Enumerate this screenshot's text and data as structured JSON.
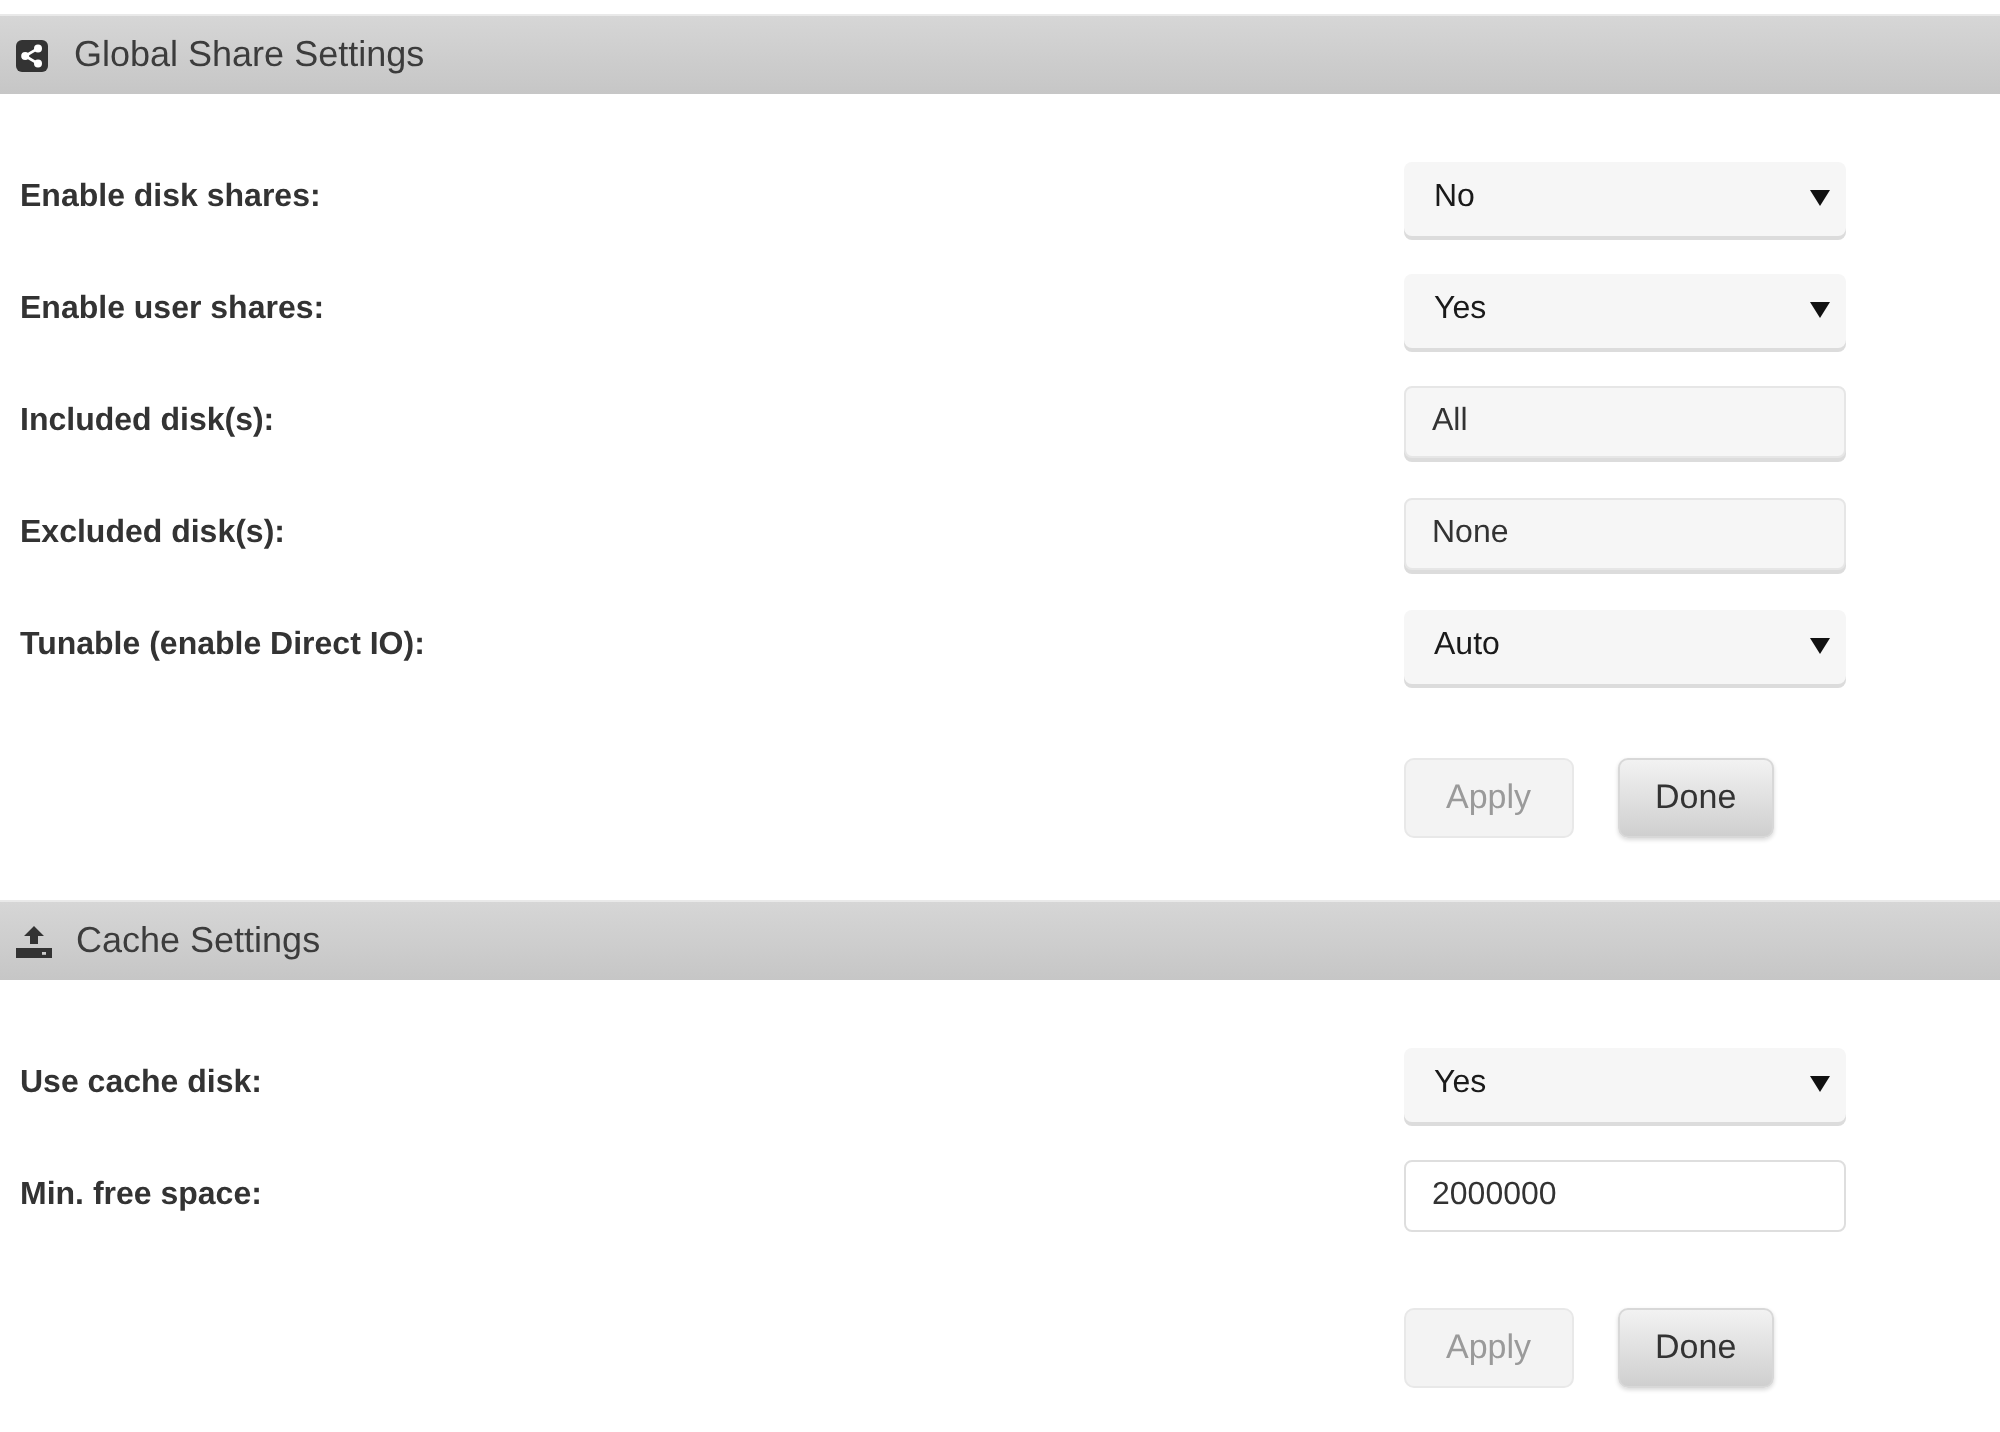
{
  "sections": [
    {
      "title": "Global Share Settings",
      "fields": [
        {
          "label": "Enable disk shares:",
          "kind": "select",
          "value": "No",
          "disabled": false
        },
        {
          "label": "Enable user shares:",
          "kind": "select",
          "value": "Yes",
          "disabled": false
        },
        {
          "label": "Included disk(s):",
          "kind": "text",
          "value": "All",
          "disabled": true
        },
        {
          "label": "Excluded disk(s):",
          "kind": "text",
          "value": "None",
          "disabled": true
        },
        {
          "label": "Tunable (enable Direct IO):",
          "kind": "select",
          "value": "Auto",
          "disabled": false
        }
      ],
      "buttons": [
        {
          "label": "Apply",
          "disabled": true
        },
        {
          "label": "Done",
          "disabled": false
        }
      ]
    },
    {
      "title": "Cache Settings",
      "fields": [
        {
          "label": "Use cache disk:",
          "kind": "select",
          "value": "Yes",
          "disabled": false
        },
        {
          "label": "Min. free space:",
          "kind": "text",
          "value": "2000000",
          "disabled": false
        }
      ],
      "buttons": [
        {
          "label": "Apply",
          "disabled": true
        },
        {
          "label": "Done",
          "disabled": false
        }
      ]
    }
  ]
}
